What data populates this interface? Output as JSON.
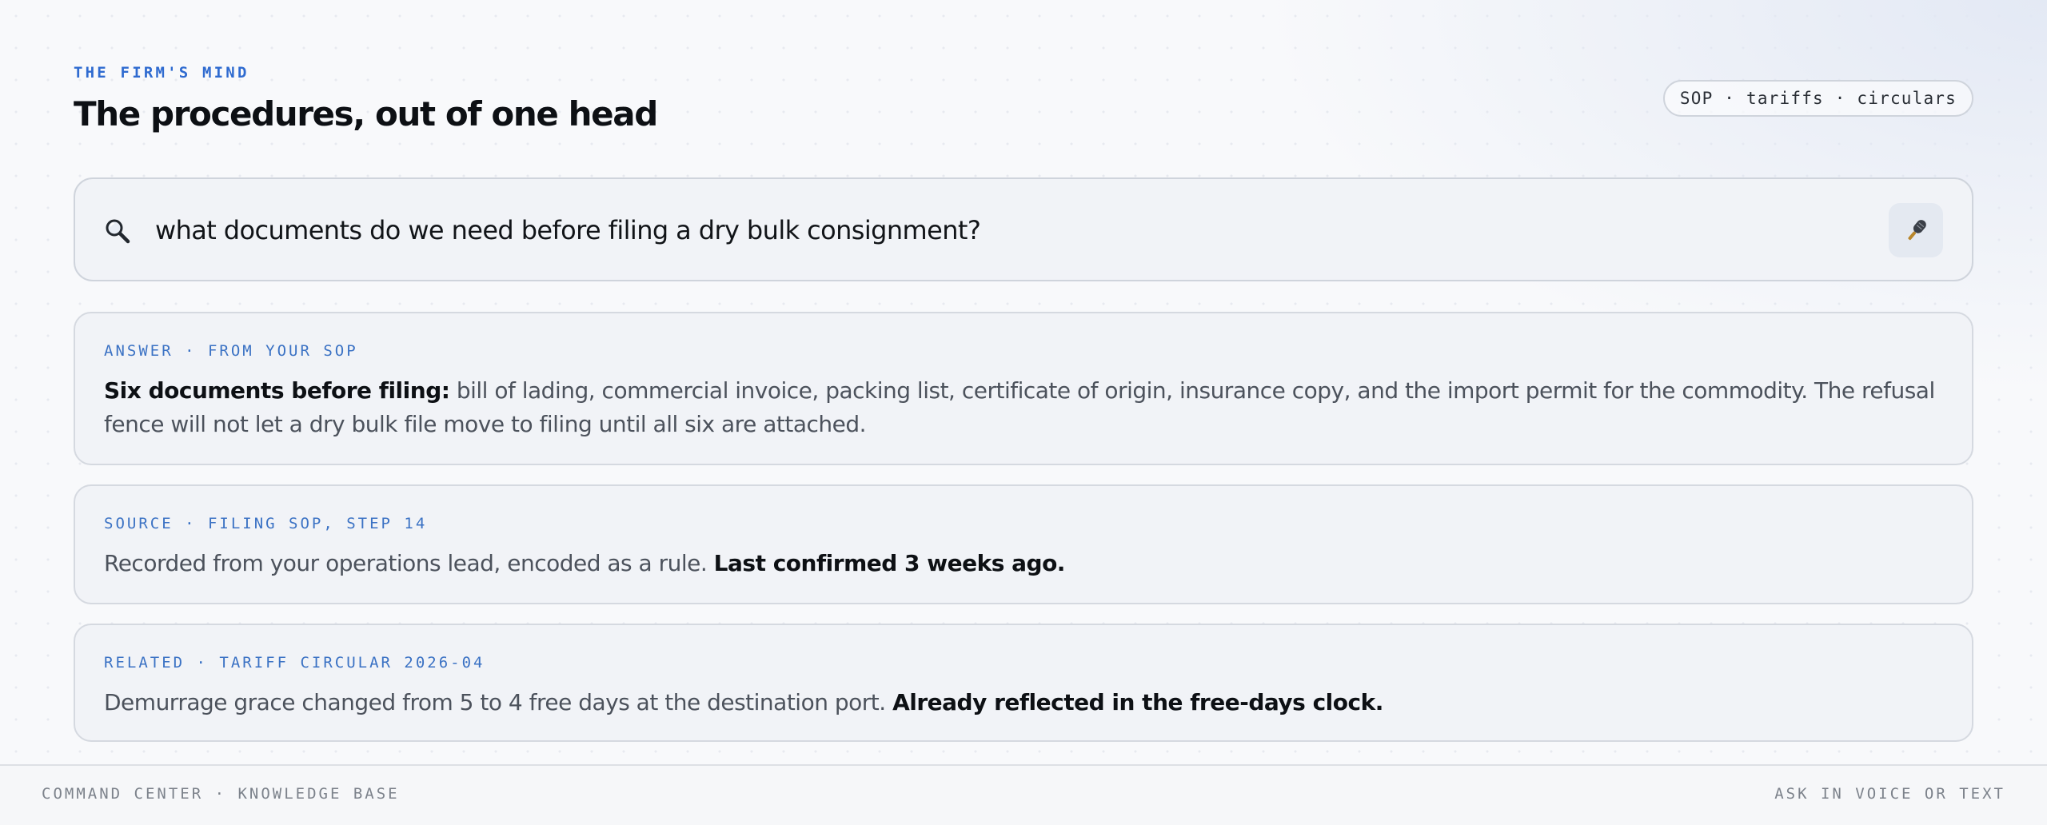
{
  "header": {
    "eyebrow": "THE FIRM'S MIND",
    "title": "The procedures, out of one head",
    "tags": "SOP · tariffs · circulars"
  },
  "search": {
    "query": "what documents do we need before filing a dry bulk consignment?",
    "icon": "search-icon",
    "mic_icon": "microphone-icon"
  },
  "cards": {
    "answer": {
      "label": "ANSWER · FROM YOUR SOP",
      "lead": "Six documents before filing:",
      "body": " bill of lading, commercial invoice, packing list, certificate of origin, insurance copy, and the import permit for the commodity. The refusal fence will not let a dry bulk file move to filing until all six are attached."
    },
    "source": {
      "label": "SOURCE · FILING SOP, STEP 14",
      "body": "Recorded from your operations lead, encoded as a rule. ",
      "emphasis": "Last confirmed 3 weeks ago."
    },
    "related": {
      "label": "RELATED · TARIFF CIRCULAR 2026-04",
      "body": "Demurrage grace changed from 5 to 4 free days at the destination port. ",
      "emphasis": "Already reflected in the free-days clock."
    }
  },
  "footer": {
    "left": "COMMAND CENTER · KNOWLEDGE BASE",
    "right": "ASK IN VOICE OR TEXT"
  },
  "colors": {
    "accent": "#2f6bd0",
    "label_blue": "#3b72c4",
    "card_bg": "#f1f3f7",
    "border": "#cfd4dc",
    "muted_text": "#4c525c",
    "footer_text": "#7c828b"
  }
}
